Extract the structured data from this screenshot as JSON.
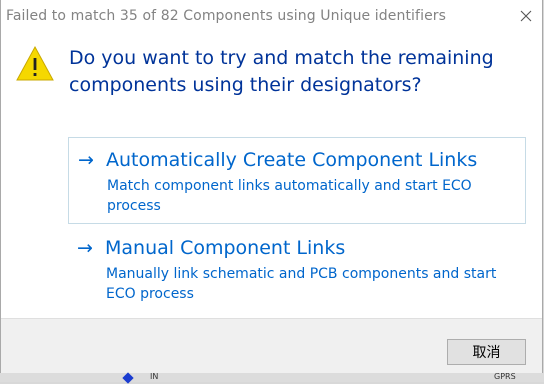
{
  "dialog": {
    "title": "Failed to match 35 of 82 Components using Unique identifiers",
    "question": "Do you want to try and match the remaining components using their designators?"
  },
  "options": [
    {
      "title": "Automatically Create Component Links",
      "description": "Match component links automatically and start ECO process",
      "icon": "arrow-right-icon"
    },
    {
      "title": "Manual Component Links",
      "description": "Manually link schematic and PCB components and start ECO process",
      "icon": "arrow-right-icon"
    }
  ],
  "footer": {
    "cancel_label": "取消"
  },
  "background": {
    "text_left": "IN",
    "text_right": "GPRS"
  },
  "colors": {
    "accent": "#0066cc",
    "heading": "#003399",
    "warning": "#f5d800"
  }
}
